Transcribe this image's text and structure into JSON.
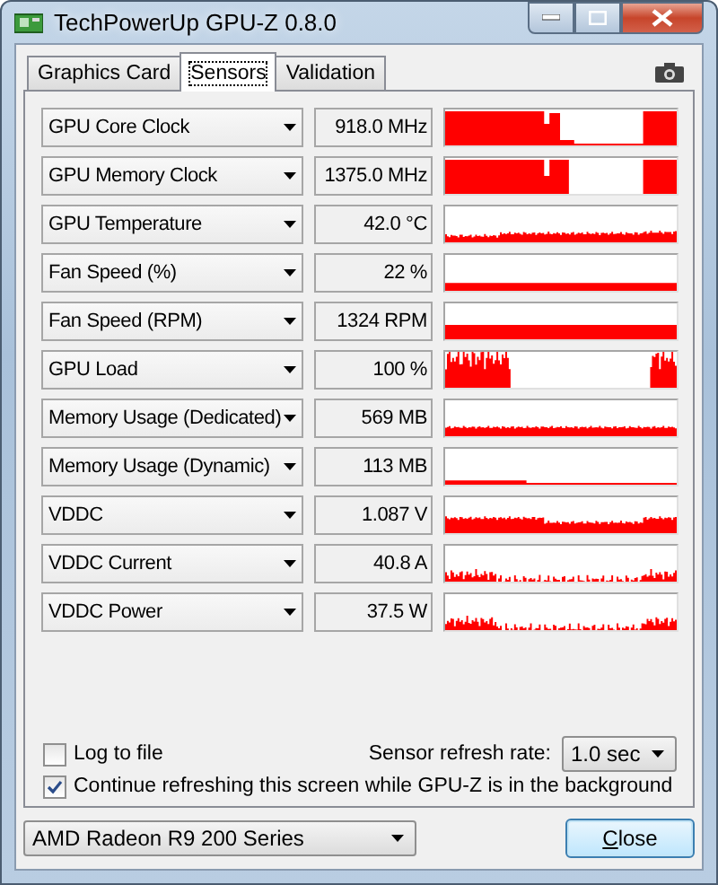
{
  "window": {
    "title": "TechPowerUp GPU-Z 0.8.0"
  },
  "tabs": [
    {
      "label": "Graphics Card",
      "selected": false
    },
    {
      "label": "Sensors",
      "selected": true
    },
    {
      "label": "Validation",
      "selected": false
    }
  ],
  "sensors": [
    {
      "name": "GPU Core Clock",
      "value": "918.0 MHz"
    },
    {
      "name": "GPU Memory Clock",
      "value": "1375.0 MHz"
    },
    {
      "name": "GPU Temperature",
      "value": "42.0 °C"
    },
    {
      "name": "Fan Speed (%)",
      "value": "22 %"
    },
    {
      "name": "Fan Speed (RPM)",
      "value": "1324 RPM"
    },
    {
      "name": "GPU Load",
      "value": "100 %"
    },
    {
      "name": "Memory Usage (Dedicated)",
      "value": "569 MB"
    },
    {
      "name": "Memory Usage (Dynamic)",
      "value": "113 MB"
    },
    {
      "name": "VDDC",
      "value": "1.087 V"
    },
    {
      "name": "VDDC Current",
      "value": "40.8 A"
    },
    {
      "name": "VDDC Power",
      "value": "37.5 W"
    }
  ],
  "log_to_file": {
    "label": "Log to file",
    "checked": false
  },
  "refresh_rate": {
    "label": "Sensor refresh rate:",
    "value": "1.0 sec"
  },
  "background_refresh": {
    "label": "Continue refreshing this screen while GPU-Z is in the background",
    "checked": true
  },
  "device_select": {
    "value": "AMD Radeon R9 200 Series"
  },
  "buttons": [
    {
      "label": "Close"
    }
  ]
}
